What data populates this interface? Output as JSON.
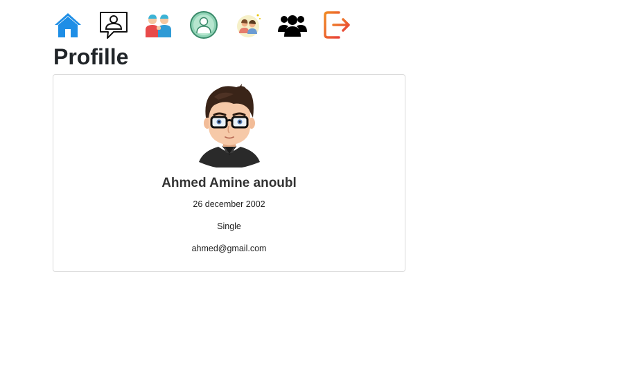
{
  "nav": {
    "items": [
      {
        "icon": "home-icon"
      },
      {
        "icon": "profile-chat-icon"
      },
      {
        "icon": "friends-icon"
      },
      {
        "icon": "user-circle-icon"
      },
      {
        "icon": "couple-icon"
      },
      {
        "icon": "group-icon"
      },
      {
        "icon": "logout-icon"
      }
    ]
  },
  "page": {
    "title": "Profille"
  },
  "profile": {
    "name": "Ahmed Amine anoubl",
    "birthdate": "26 december 2002",
    "status": "Single",
    "email": "ahmed@gmail.com"
  },
  "colors": {
    "home_blue": "#1e8ee6",
    "logout_orange": "#f08a24",
    "logout_red": "#e8423a",
    "card_border": "#d9d9d9"
  }
}
